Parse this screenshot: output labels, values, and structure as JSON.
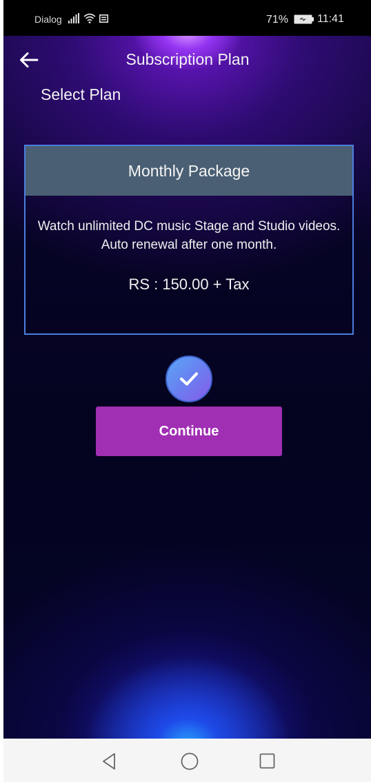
{
  "status_bar": {
    "carrier": "Dialog",
    "battery_percent": "71%",
    "time": "11:41",
    "icons": [
      "signal-icon",
      "wifi-icon",
      "message-icon",
      "battery-icon"
    ]
  },
  "header": {
    "back_icon": "arrow-left-icon",
    "title": "Subscription Plan"
  },
  "section_label": "Select Plan",
  "plan": {
    "name": "Monthly Package",
    "description": "Watch unlimited DC music Stage and Studio videos. Auto renewal after one month.",
    "price": "RS : 150.00 + Tax",
    "selected": true,
    "selected_icon": "checkmark-icon"
  },
  "continue_label": "Continue",
  "nav_bar": {
    "icons": [
      "triangle-back-icon",
      "circle-home-icon",
      "square-recents-icon"
    ]
  },
  "colors": {
    "card_border": "#4a7fe0",
    "card_header": "#4a5f73",
    "button": "#a02fb3",
    "badge_start": "#5aa7f5",
    "badge_end": "#8a5be8"
  }
}
